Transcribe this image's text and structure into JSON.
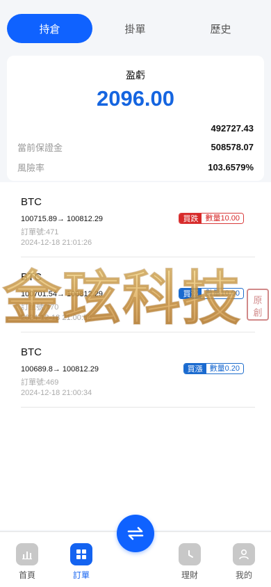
{
  "tabs": [
    {
      "label": "持倉",
      "active": true
    },
    {
      "label": "掛單",
      "active": false
    },
    {
      "label": "歷史",
      "active": false
    }
  ],
  "summary": {
    "pnl_label": "盈虧",
    "pnl_value": "2096.00",
    "equity": "492727.43",
    "margin_label": "當前保證金",
    "margin_value": "508578.07",
    "risk_label": "風險率",
    "risk_value": "103.6579%"
  },
  "orders": [
    {
      "symbol": "BTC",
      "price": "100715.89→ 100812.29",
      "order_no": "訂單號:471",
      "time": "2024-12-18 21:01:26",
      "side": "買跌",
      "qty": "數量10.00",
      "direction": "down"
    },
    {
      "symbol": "BTC",
      "price": "100701.54→ 100812.29",
      "order_no": "訂單號:470",
      "time": "2024-12-18 21:00:56",
      "side": "買漲",
      "qty": "數量10.00",
      "direction": "up"
    },
    {
      "symbol": "BTC",
      "price": "100689.8→ 100812.29",
      "order_no": "訂單號:469",
      "time": "2024-12-18 21:00:34",
      "side": "買漲",
      "qty": "數量0.20",
      "direction": "up"
    }
  ],
  "watermark": {
    "text": "金玹科技",
    "seal": "原創"
  },
  "nav": [
    {
      "label": "首頁",
      "icon": "chart-icon",
      "active": false
    },
    {
      "label": "訂單",
      "icon": "grid-icon",
      "active": true
    },
    {
      "label": "理財",
      "icon": "clock-icon",
      "active": false
    },
    {
      "label": "我的",
      "icon": "user-icon",
      "active": false
    }
  ],
  "fab": {
    "icon": "swap-arrows-icon"
  },
  "colors": {
    "primary": "#0f62ff",
    "pnl": "#1565e0",
    "sell": "#d72a2a",
    "buy": "#1a6ad0"
  }
}
